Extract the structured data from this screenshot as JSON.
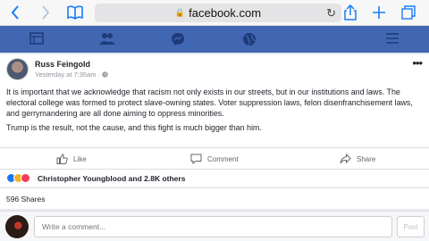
{
  "browser": {
    "url": "facebook.com",
    "icons": [
      "back-icon",
      "forward-icon",
      "bookmarks-icon",
      "lock-icon",
      "reload-icon",
      "share-icon",
      "new-tab-icon",
      "tabs-icon"
    ]
  },
  "fb_nav": {
    "color": "#4267b2",
    "tabs": [
      "news-feed-icon",
      "friends-icon",
      "messenger-icon",
      "globe-icon",
      "menu-icon"
    ]
  },
  "post": {
    "author": "Russ Feingold",
    "timestamp": "Yesterday at 7:35am · ",
    "paragraphs": [
      "It is important that we acknowledge that racism not only exists in our streets, but in our institutions and laws. The electoral college was formed to protect slave-owning states. Voter suppression laws, felon disenfranchisement laws, and gerrymandering are all done aiming to oppress minorities.",
      "Trump is the result, not the cause, and this fight is much bigger than him."
    ],
    "actions": {
      "like": "Like",
      "comment": "Comment",
      "share": "Share"
    },
    "reactions_text": "Christopher Youngblood and 2.8K others",
    "reaction_icons": [
      "like-reaction-icon",
      "sad-reaction-icon",
      "love-reaction-icon"
    ],
    "shares": "596 Shares"
  },
  "comment": {
    "placeholder": "Write a comment...",
    "post_label": "Post"
  }
}
